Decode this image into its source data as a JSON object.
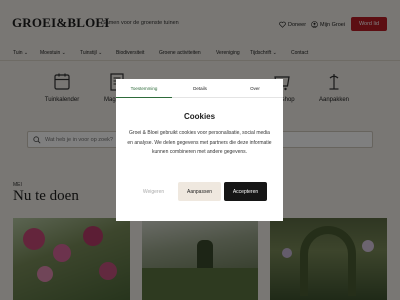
{
  "header": {
    "logo": "GROEI&BLOEI",
    "tagline": "Samen voor de groenste tuinen",
    "donate_label": "Doneer",
    "account_label": "Mijn Groei",
    "member_label": "Word lid"
  },
  "nav": {
    "items": [
      "Tuin",
      "Moestuin",
      "Tuinstijl",
      "Biodiversiteit",
      "Groene activiteiten",
      "Vereniging",
      "Tijdschrift",
      "Contact"
    ]
  },
  "categories": {
    "items": [
      {
        "label": "Tuinkalender",
        "icon": "calendar-icon"
      },
      {
        "label": "Magazine",
        "icon": "magazine-icon"
      },
      {
        "label": "Webshop",
        "icon": "shop-icon"
      },
      {
        "label": "Aanpakken",
        "icon": "tools-icon"
      }
    ]
  },
  "search": {
    "placeholder": "Wat heb je in voor op zoek?"
  },
  "section": {
    "kicker": "MEI",
    "title": "Nu te doen"
  },
  "cookie_modal": {
    "tabs": [
      "Toestemming",
      "Details",
      "Over"
    ],
    "active_tab": "Toestemming",
    "title": "Cookies",
    "text": "Groei & Bloei gebruikt cookies voor personalisatie, social media en analyse. We delen gegevens met partners die deze informatie kunnen combineren met andere gegevens.",
    "reject_label": "Weigeren",
    "customize_label": "Aanpassen",
    "accept_label": "Accepteren"
  },
  "colors": {
    "brand_red": "#b81c25",
    "accent_green": "#2e6b3a",
    "background": "#f2efe9"
  }
}
